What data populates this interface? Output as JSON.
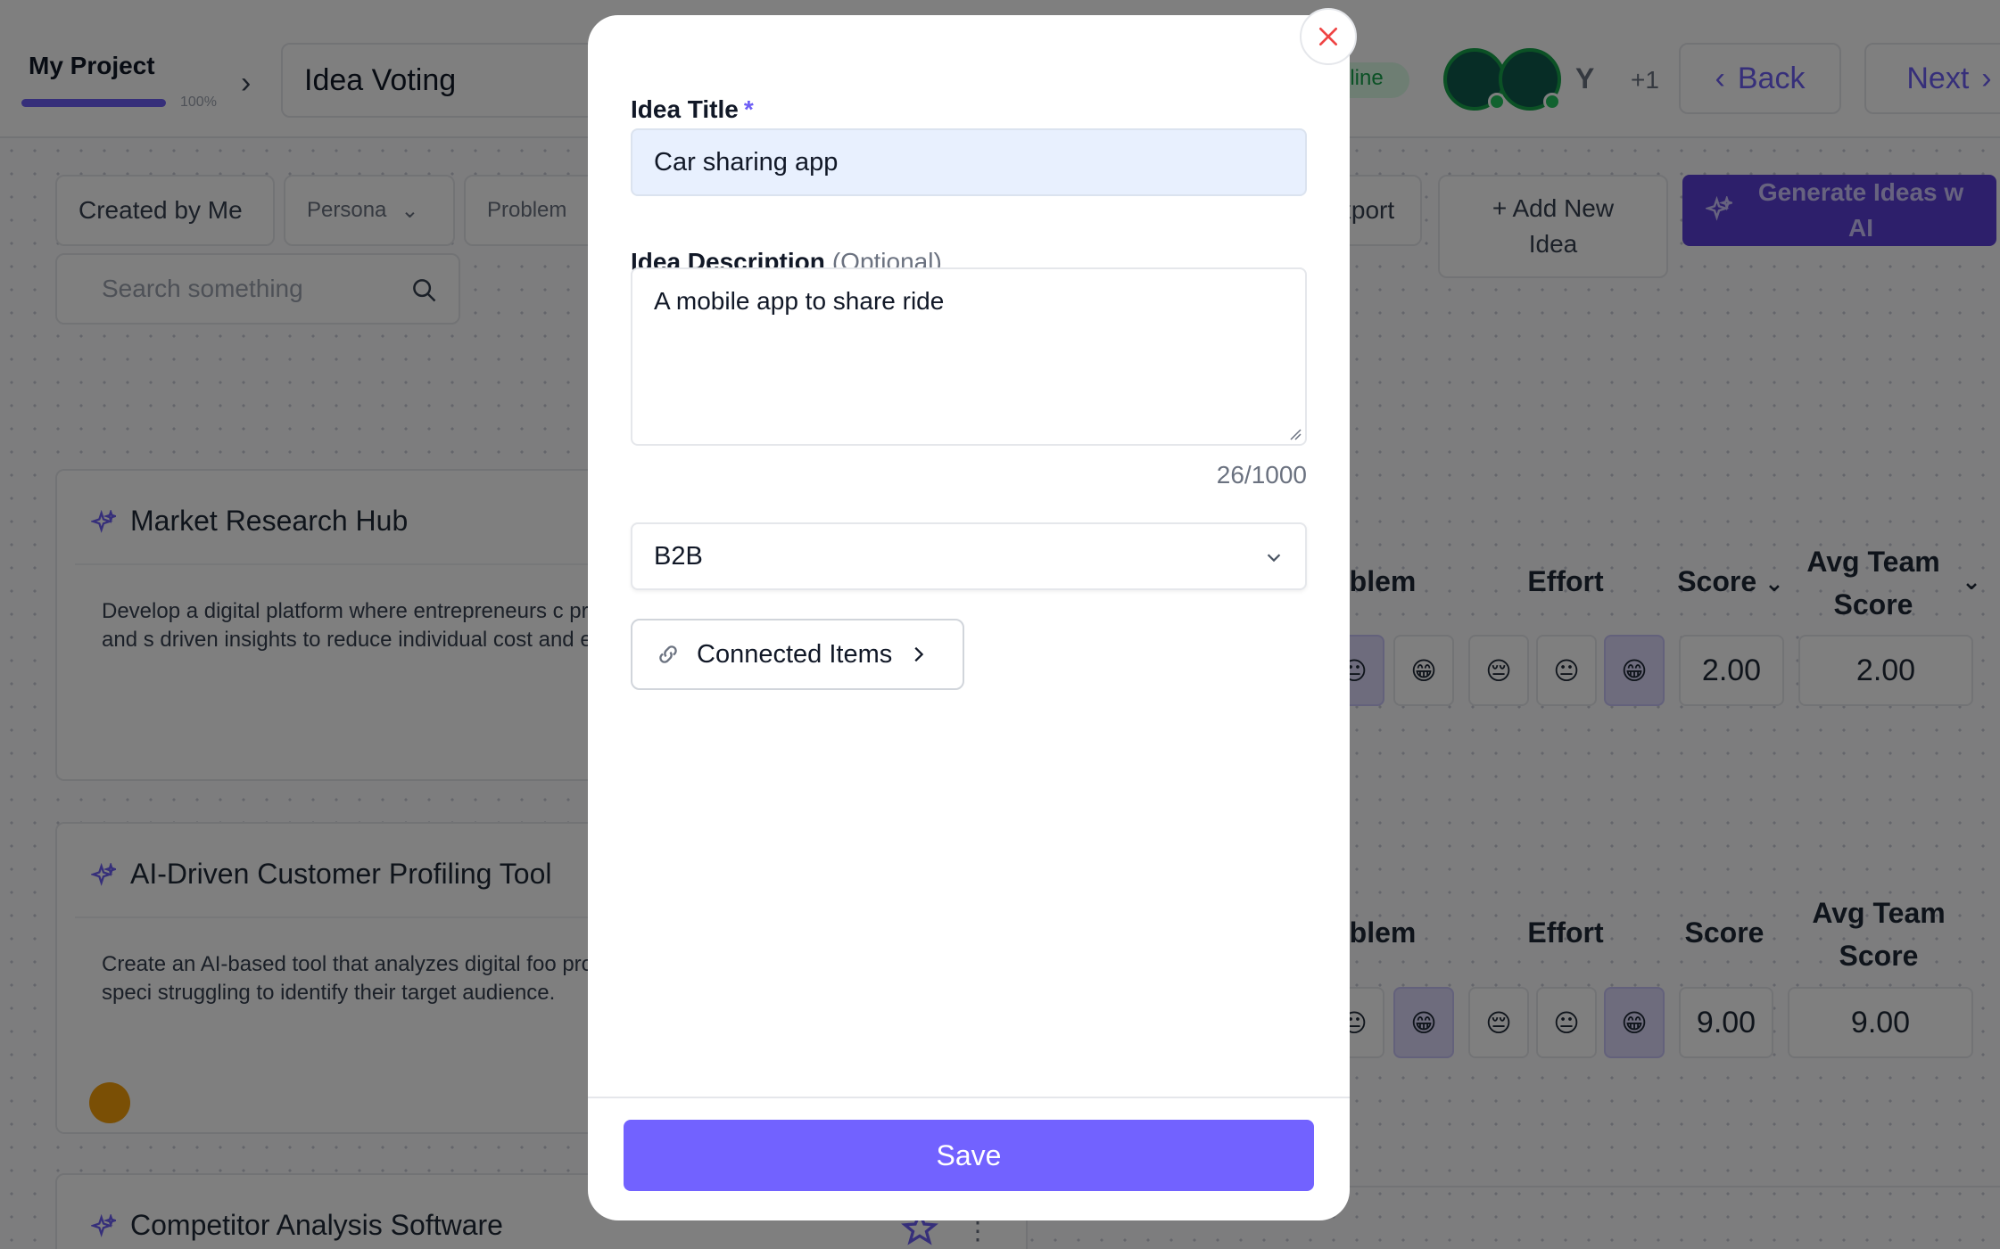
{
  "colors": {
    "accent": "#6d5ef5",
    "save_button": "#7262ff",
    "required_star": "#6d5ef5",
    "close_icon": "#ef4444",
    "online": "#16a34a"
  },
  "header": {
    "project_name": "My Project",
    "project_progress": "100%",
    "page_title": "Idea Voting",
    "online_status": "nline",
    "user_initial": "Y",
    "more_users": "+1",
    "back_label": "Back",
    "next_label": "Next"
  },
  "toolbar": {
    "created_by_me": "Created by Me",
    "persona_filter": "Persona",
    "problem_filter": "Problem",
    "search_placeholder": "Search something",
    "export_label": "xport",
    "add_new_idea_label": "+ Add New Idea",
    "generate_ai_label": "Generate Ideas w AI"
  },
  "ideas": [
    {
      "title": "Market Research Hub",
      "description": "Develop a digital platform where entrepreneurs c projects, enabling collective data gathering and s driven insights to reduce individual cost and effo",
      "columns": {
        "problem": "blem",
        "effort": "Effort",
        "score": "Score",
        "avg_team_score": "Avg Team Score"
      },
      "score": "2.00",
      "avg_team_score": "2.00"
    },
    {
      "title": "AI-Driven Customer Profiling Tool",
      "description": "Create an AI-based tool that analyzes digital foo provide comprehensive customer profiles, speci struggling to identify their target audience.",
      "columns": {
        "problem": "blem",
        "effort": "Effort",
        "score": "Score",
        "avg_team_score": "Avg Team Score"
      },
      "score": "9.00",
      "avg_team_score": "9.00"
    },
    {
      "title": "Competitor Analysis Software"
    }
  ],
  "modal": {
    "title_label": "Idea Title",
    "required_mark": "*",
    "title_value": "Car sharing app",
    "description_label": "Idea Description",
    "description_optional": "(Optional)",
    "description_value": "A mobile app to share ride",
    "char_count": "26/1000",
    "category_value": "B2B",
    "connected_items_label": "Connected Items",
    "save_label": "Save"
  },
  "icons": {
    "close": "close-icon",
    "link": "link-icon",
    "chevron_right": "chevron-right-icon",
    "chevron_down": "chevron-down-icon",
    "search": "search-icon",
    "sparkle": "sparkle-icon",
    "star": "star-icon"
  }
}
